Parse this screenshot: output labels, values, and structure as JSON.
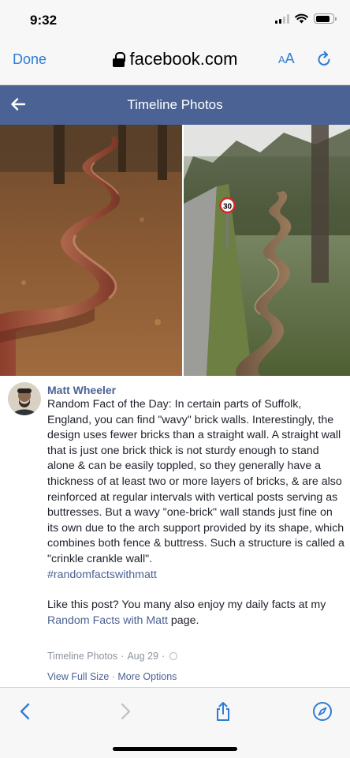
{
  "status": {
    "time": "9:32",
    "battery_level": 0.85
  },
  "browser": {
    "done_label": "Done",
    "url": "facebook.com",
    "text_size_label_small": "A",
    "text_size_label_large": "A",
    "accent_color": "#2c7cd6"
  },
  "header": {
    "title": "Timeline Photos",
    "background_color": "#4a6394"
  },
  "post": {
    "author": "Matt Wheeler",
    "text": "Random Fact of the Day: In certain parts of Suffolk, England, you can find \"wavy\" brick walls. Interestingly, the design uses fewer bricks than a straight wall. A straight wall that is just one brick thick is not sturdy enough to stand alone & can be easily toppled, so they generally have a thickness of at least two or more layers of bricks, & are also reinforced at regular intervals with vertical posts serving as buttresses. But a wavy \"one-brick\" wall stands just fine on its own due to the arch support provided by its shape, which combines both fence & buttress. Such a structure is called a \"crinkle crankle wall\".",
    "hashtag": "#randomfactswithmatt",
    "cta_prefix": "Like this post? You many also enjoy my daily facts at my ",
    "cta_link": "Random Facts with Matt",
    "cta_suffix": " page.",
    "meta_album": "Timeline Photos",
    "meta_sep1": " · ",
    "meta_date": "Aug 29",
    "meta_sep2": " · ",
    "view_full_size": "View Full Size",
    "actions_sep": " · ",
    "more_options": "More Options",
    "sign_speed": "30"
  },
  "toolbar": {
    "back_icon": "chevron-left-icon",
    "forward_icon": "chevron-right-icon",
    "share_icon": "share-icon",
    "bookmarks_icon": "compass-icon"
  }
}
